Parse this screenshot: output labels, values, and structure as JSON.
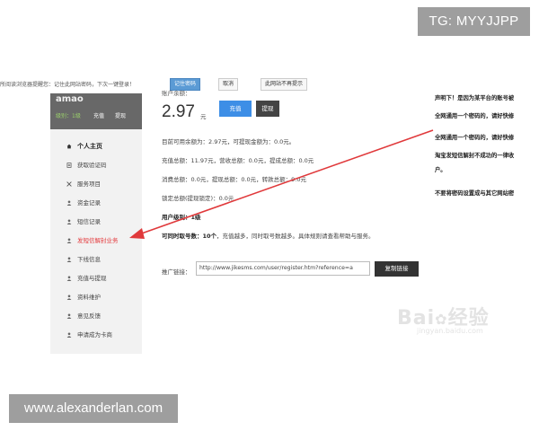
{
  "watermarks": {
    "top_right": "TG: MYYJJPP",
    "bottom_left": "www.alexanderlan.com"
  },
  "password_bar": {
    "text": "所阅读浏览器提醒您：记住此网站密码，下次一键登录！",
    "remember_label": "记住密码",
    "cancel_label": "取消",
    "never_label": "此网站不再提示"
  },
  "sidebar": {
    "username": "amao",
    "level": "级别：1级",
    "recharge_link": "充值",
    "withdraw_link": "提现",
    "items": [
      {
        "label": "个人主页",
        "icon": "home-icon"
      },
      {
        "label": "获取验证码",
        "icon": "document-icon"
      },
      {
        "label": "服务项目",
        "icon": "grid-icon"
      },
      {
        "label": "资金记录",
        "icon": "user-icon"
      },
      {
        "label": "短信记录",
        "icon": "user-icon"
      },
      {
        "label": "发短信解封业务",
        "icon": "user-icon"
      },
      {
        "label": "下线信息",
        "icon": "user-icon"
      },
      {
        "label": "充值与提现",
        "icon": "user-icon"
      },
      {
        "label": "资料维护",
        "icon": "user-icon"
      },
      {
        "label": "意见反馈",
        "icon": "user-icon"
      },
      {
        "label": "申请成为卡商",
        "icon": "user-icon"
      }
    ],
    "active_index": 5
  },
  "main": {
    "balance_label": "账户余额：",
    "balance_value": "2.97",
    "balance_unit": "元",
    "recharge_button": "充值",
    "withdraw_button": "提现",
    "lines": [
      "目前可用余额为：2.97元，可提现金额为：0.0元。",
      "充值总额：11.97元，营收总额：0.0元，提成总额：0.0元",
      "消费总额：0.0元，提现总额：0.0元，转款总额：9.0元",
      "锁定总额(提现锁定)：0.0元"
    ],
    "user_level_label": "用户级别：",
    "user_level_value": "1级",
    "fetch_count_label": "可同时取号数：",
    "fetch_count_value": "10个",
    "fetch_count_note": "，充值越多，同时取号数越多。具体规则请查看帮助与服务。",
    "promo_label": "推广链接：",
    "promo_url": "http://www.jikesms.com/user/register.htm?reference=a",
    "copy_button": "复制链接"
  },
  "right_column": {
    "lines": [
      "声明下！是因为某平台的账号被",
      "全网通用一个密码的，请好快修",
      "全网通用一个密码的，请好快修",
      "淘宝发短信解封不成功的一律收",
      "户。",
      "不要将密码设置成与其它网站密"
    ]
  },
  "baidu_watermark": {
    "logo_text": "Bai",
    "logo_text2": "经验",
    "url": "jingyan.baidu.com"
  },
  "colors": {
    "primary_blue": "#3d8ee6",
    "dark_button": "#444444",
    "active_red": "#e4393c",
    "arrow_red": "#e0393b"
  }
}
